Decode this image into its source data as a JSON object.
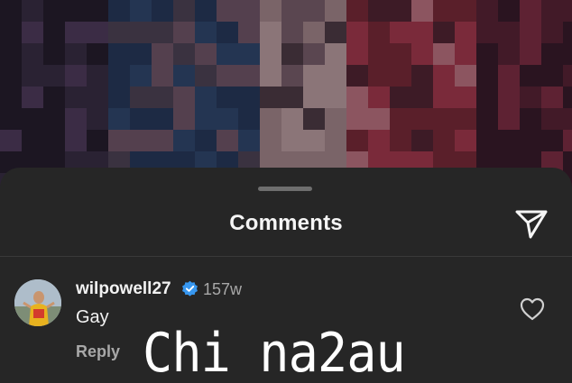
{
  "sheet": {
    "title": "Comments"
  },
  "comment": {
    "username": "wilpowell27",
    "verified": true,
    "timestamp": "157w",
    "text": "Gay",
    "reply_label": "Reply",
    "icons": {
      "verified": "verified-badge-icon",
      "like": "heart-icon",
      "share": "send-icon"
    }
  },
  "watermark": {
    "text": "Chi na2au"
  },
  "colors": {
    "sheet_bg": "#262626",
    "text_primary": "#f2f2f2",
    "text_secondary": "#a8a8a8",
    "verified_blue": "#3797f0"
  }
}
